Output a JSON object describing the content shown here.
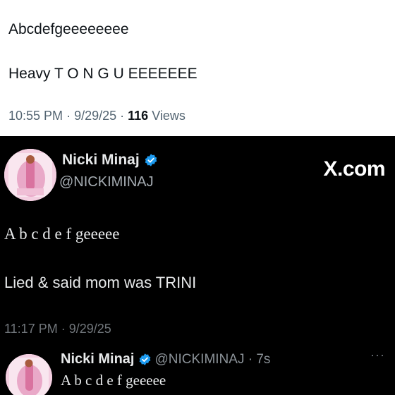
{
  "top_tweet": {
    "line1": "Abcdefgeeeeeeee",
    "line2": "Heavy T O N G U EEEEEEE",
    "time": "10:55 PM",
    "date": "9/29/25",
    "views_count": "116",
    "views_label": "Views"
  },
  "main_tweet": {
    "display_name": "Nicki Minaj",
    "handle": "@NICKIMINAJ",
    "brand": "X.com",
    "text1": "A b c d e f geeeee",
    "text2": "Lied & said mom was TRINI",
    "timestamp": "11:17 PM · 9/29/25",
    "verified_icon": "verified-badge-icon"
  },
  "reply": {
    "display_name": "Nicki Minaj",
    "handle_time": "@NICKIMINAJ · 7s",
    "text": "A b c d e f geeeee",
    "more_label": "···"
  },
  "colors": {
    "verified_blue": "#1d9bf0",
    "background_dark": "#000000",
    "background_light": "#ffffff"
  }
}
